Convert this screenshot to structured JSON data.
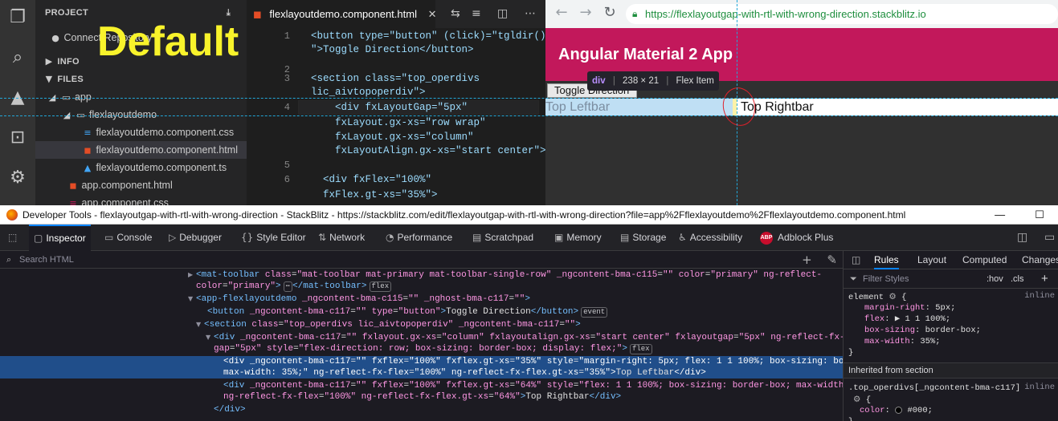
{
  "overlay_label": "Default",
  "explorer": {
    "project_label": "PROJECT",
    "connect_label": "Connect Repository",
    "info_label": "INFO",
    "files_label": "FILES",
    "tree": [
      {
        "name": "app"
      },
      {
        "name": "flexlayoutdemo"
      },
      {
        "name": "flexlayoutdemo.component.css"
      },
      {
        "name": "flexlayoutdemo.component.html"
      },
      {
        "name": "flexlayoutdemo.component.ts"
      },
      {
        "name": "app.component.html"
      },
      {
        "name": "app.component.css"
      }
    ]
  },
  "editor": {
    "tab_title": "flexlayoutdemo.component.html",
    "lines": [
      {
        "num": "1",
        "text": "<button type=\"button\" (click)=\"tgldir()"
      },
      {
        "num": "",
        "text": "\">Toggle Direction</button>"
      },
      {
        "num": "2",
        "text": ""
      },
      {
        "num": "3",
        "text": "<section class=\"top_operdivs"
      },
      {
        "num": "",
        "text": "lic_aivtopoperdiv\">"
      },
      {
        "num": "4",
        "text": "    <div fxLayoutGap=\"5px\""
      },
      {
        "num": "",
        "text": "    fxLayout.gx-xs=\"row wrap\""
      },
      {
        "num": "",
        "text": "    fxLayout.gx-xs=\"column\""
      },
      {
        "num": "",
        "text": "    fxLayoutAlign.gx-xs=\"start center\">"
      },
      {
        "num": "5",
        "text": ""
      },
      {
        "num": "6",
        "text": "  <div fxFlex=\"100%\""
      },
      {
        "num": "",
        "text": "  fxFlex.gt-xs=\"35%\">"
      }
    ]
  },
  "browser": {
    "url": "https://flexlayoutgap-with-rtl-with-wrong-direction.stackblitz.io",
    "toolbar_title": "Angular Material 2 App",
    "toggle_button": "Toggle Direction",
    "left_text": "Top Leftbar",
    "right_text": "Top Rightbar",
    "tooltip": {
      "tag": "div",
      "size": "238 × 21",
      "kind": "Flex Item"
    }
  },
  "devtools": {
    "title": "Developer Tools - flexlayoutgap-with-rtl-with-wrong-direction - StackBlitz - https://stackblitz.com/edit/flexlayoutgap-with-rtl-with-wrong-direction?file=app%2Fflexlayoutdemo%2Fflexlayoutdemo.component.html",
    "tabs": [
      {
        "icon": "▢",
        "label": "Inspector"
      },
      {
        "icon": "▭",
        "label": "Console"
      },
      {
        "icon": "▷",
        "label": "Debugger"
      },
      {
        "icon": "{}",
        "label": "Style Editor"
      },
      {
        "icon": "⇅",
        "label": "Network"
      },
      {
        "icon": "◔",
        "label": "Performance"
      },
      {
        "icon": "▤",
        "label": "Scratchpad"
      },
      {
        "icon": "▣",
        "label": "Memory"
      },
      {
        "icon": "▤",
        "label": "Storage"
      },
      {
        "icon": "♿",
        "label": "Accessibility"
      },
      {
        "icon": "ABP",
        "label": "Adblock Plus"
      }
    ],
    "search_placeholder": "Search HTML",
    "markup": [
      "<mat-toolbar class=\"mat-toolbar mat-primary mat-toolbar-single-row\" _ngcontent-bma-c115=\"\" color=\"primary\" ng-reflect-",
      "color=\"primary\">⋯</mat-toolbar>",
      "<app-flexlayoutdemo _ngcontent-bma-c115=\"\" _nghost-bma-c117=\"\">",
      "<button _ngcontent-bma-c117=\"\" type=\"button\">Toggle Direction</button>",
      "<section class=\"top_operdivs lic_aivtopoperdiv\" _ngcontent-bma-c117=\"\">",
      "<div _ngcontent-bma-c117=\"\" fxlayout.gx-xs=\"column\" fxlayoutalign.gx-xs=\"start center\" fxlayoutgap=\"5px\" ng-reflect-fx-layout-",
      "gap=\"5px\" style=\"flex-direction: row; box-sizing: border-box; display: flex;\">",
      "<div _ngcontent-bma-c117=\"\" fxflex=\"100%\" fxflex.gt-xs=\"35%\" style=\"margin-right: 5px; flex: 1 1 100%; box-sizing: border-box;",
      "max-width: 35%;\" ng-reflect-fx-flex=\"100%\" ng-reflect-fx-flex.gt-xs=\"35%\">Top Leftbar</div>",
      "<div _ngcontent-bma-c117=\"\" fxflex=\"100%\" fxflex.gt-xs=\"64%\" style=\"flex: 1 1 100%; box-sizing: border-box; max-width: 64%;\"",
      "ng-reflect-fx-flex=\"100%\" ng-reflect-fx-flex.gt-xs=\"64%\">Top Rightbar</div>",
      "</div>"
    ],
    "badges": {
      "flex": "flex",
      "event": "event",
      "more": "⋯"
    },
    "rules_tabs": [
      "Rules",
      "Layout",
      "Computed",
      "Changes"
    ],
    "filter_placeholder": "Filter Styles",
    "hov": ":hov",
    "cls": ".cls",
    "element_rule": {
      "selector": "element",
      "source": "inline",
      "props": [
        {
          "name": "margin-right",
          "value": "5px;"
        },
        {
          "name": "flex",
          "value": "▶ 1 1 100%;"
        },
        {
          "name": "box-sizing",
          "value": "border-box;"
        },
        {
          "name": "max-width",
          "value": "35%;"
        }
      ]
    },
    "inherited_label": "Inherited from section",
    "inherited_rule": {
      "selector": ".top_operdivs[_ngcontent-bma-c117]",
      "source": "inline",
      "props": [
        {
          "name": "color",
          "value": "#000;"
        }
      ]
    }
  }
}
